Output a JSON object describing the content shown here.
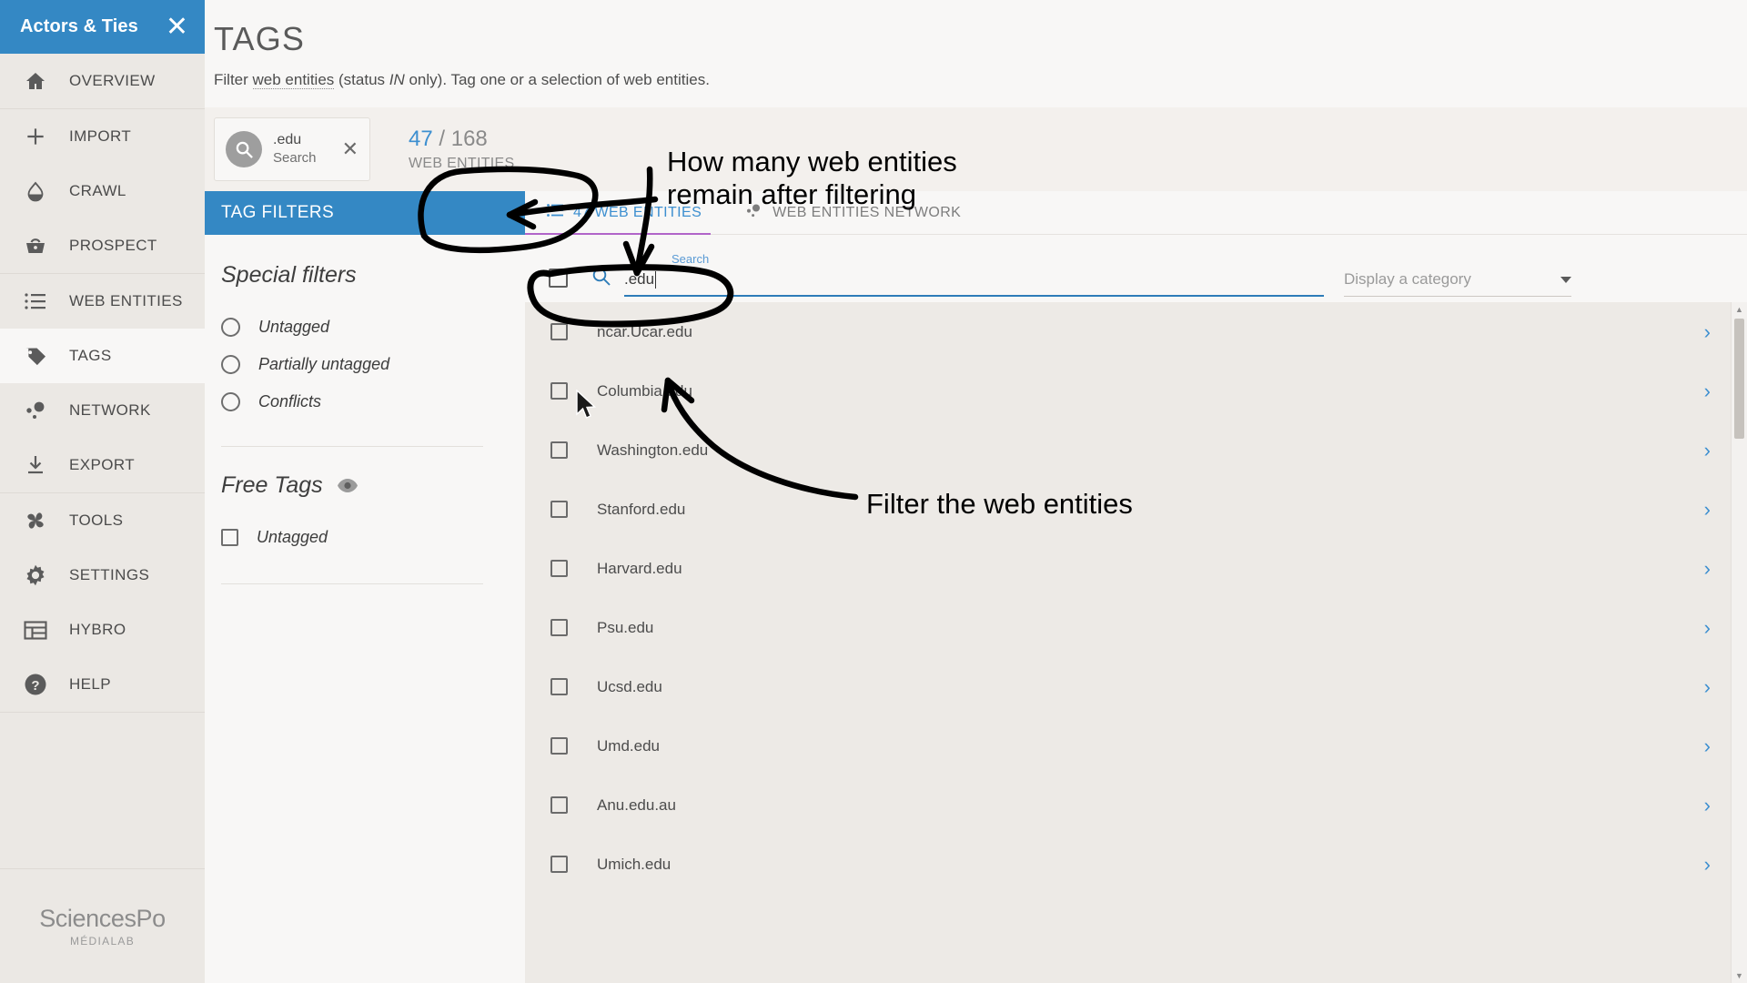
{
  "sidebar": {
    "title": "Actors & Ties",
    "close_icon": "close-icon",
    "brand": {
      "main": "SciencesPo",
      "sub": "MÉDIALAB"
    },
    "groups": [
      {
        "items": [
          {
            "label": "OVERVIEW",
            "icon": "home-icon",
            "active": false
          }
        ]
      },
      {
        "items": [
          {
            "label": "IMPORT",
            "icon": "plus-icon",
            "active": false
          },
          {
            "label": "CRAWL",
            "icon": "droplet-icon",
            "active": false
          },
          {
            "label": "PROSPECT",
            "icon": "basket-icon",
            "active": false
          }
        ]
      },
      {
        "items": [
          {
            "label": "WEB ENTITIES",
            "icon": "list-icon",
            "active": false
          },
          {
            "label": "TAGS",
            "icon": "tag-icon",
            "active": true
          },
          {
            "label": "NETWORK",
            "icon": "network-icon",
            "active": false
          },
          {
            "label": "EXPORT",
            "icon": "download-icon",
            "active": false
          }
        ]
      },
      {
        "items": [
          {
            "label": "TOOLS",
            "icon": "pinwheel-icon",
            "active": false
          },
          {
            "label": "SETTINGS",
            "icon": "gear-icon",
            "active": false
          },
          {
            "label": "HYBRO",
            "icon": "layout-icon",
            "active": false
          },
          {
            "label": "HELP",
            "icon": "question-icon",
            "active": false
          }
        ]
      }
    ]
  },
  "page": {
    "title": "TAGS",
    "subtitle_1": "Filter ",
    "subtitle_link": "web entities",
    "subtitle_2": " (status ",
    "subtitle_em": "IN",
    "subtitle_3": " only). Tag one or a selection of web entities."
  },
  "chip": {
    "icon": "search-icon",
    "value": ".edu",
    "label": "Search",
    "close_icon": "close-icon"
  },
  "counter": {
    "filtered": "47",
    "separator": " / ",
    "total": "168",
    "label": "WEB ENTITIES"
  },
  "filters": {
    "header": "TAG FILTERS",
    "special_title": "Special filters",
    "special_options": [
      {
        "label": "Untagged",
        "checked": false
      },
      {
        "label": "Partially untagged",
        "checked": false
      },
      {
        "label": "Conflicts",
        "checked": false
      }
    ],
    "free_tags_title": "Free Tags",
    "free_tags_eye_icon": "eye-icon",
    "free_tags_options": [
      {
        "label": "Untagged",
        "checked": false
      }
    ]
  },
  "tabs": [
    {
      "label": "47 WEB ENTITIES",
      "icon": "list-icon",
      "active": true
    },
    {
      "label": "WEB ENTITIES NETWORK",
      "icon": "network-icon",
      "active": false
    }
  ],
  "search": {
    "mini_label": "Search",
    "icon": "search-icon",
    "value": ".edu",
    "select_all_checkbox": false
  },
  "category": {
    "placeholder": "Display a category",
    "caret_icon": "chevron-down-icon"
  },
  "entities": [
    {
      "name": "ncar.Ucar.edu"
    },
    {
      "name": "Columbia.edu"
    },
    {
      "name": "Washington.edu"
    },
    {
      "name": "Stanford.edu"
    },
    {
      "name": "Harvard.edu"
    },
    {
      "name": "Psu.edu"
    },
    {
      "name": "Ucsd.edu"
    },
    {
      "name": "Umd.edu"
    },
    {
      "name": "Anu.edu.au"
    },
    {
      "name": "Umich.edu"
    }
  ],
  "annotations": [
    {
      "text_line_1": "How many web entities",
      "text_line_2": "remain after filtering"
    },
    {
      "text_line_1": "Filter the web entities"
    }
  ],
  "colors": {
    "accent_blue": "#3488c4",
    "link_blue": "#3d8fd0",
    "tab_underline_purple": "#b164c9",
    "sidebar_bg": "#ebe8e4",
    "list_bg": "#edeae6"
  }
}
